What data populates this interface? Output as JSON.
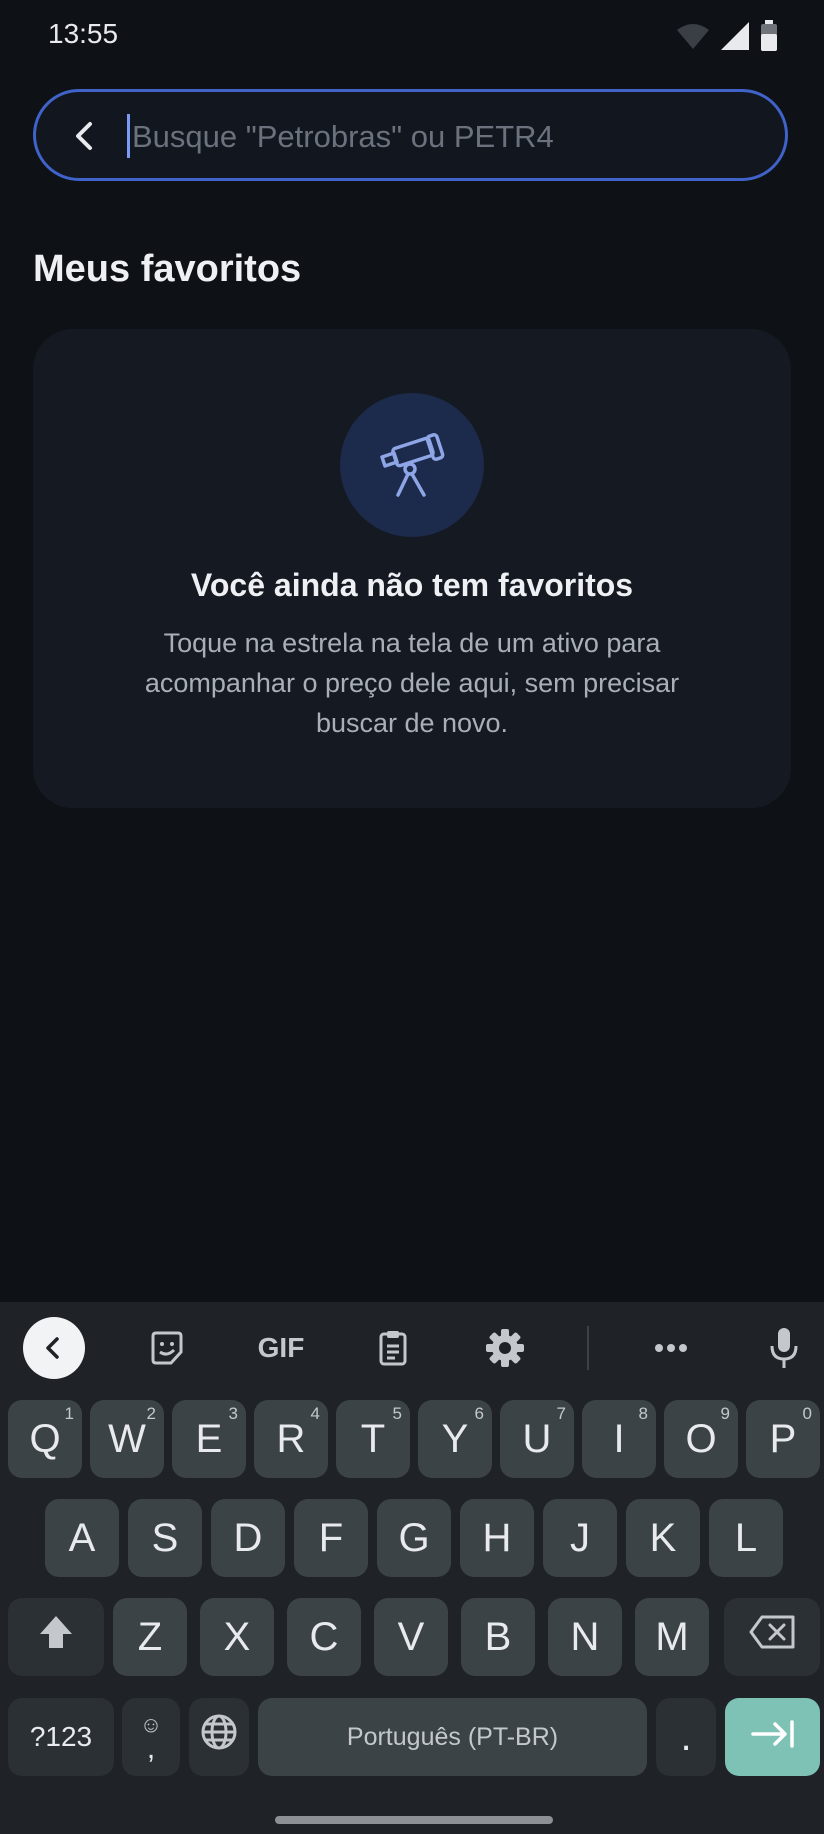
{
  "status_bar": {
    "time": "13:55",
    "icons": [
      "wifi-icon",
      "signal-icon",
      "battery-icon"
    ]
  },
  "search": {
    "placeholder": "Busque \"Petrobras\" ou PETR4",
    "value": ""
  },
  "favorites": {
    "section_title": "Meus favoritos",
    "empty_title": "Você ainda não tem favoritos",
    "empty_description": "Toque na estrela na tela de um ativo para acompanhar o preço dele aqui, sem precisar buscar de novo.",
    "icon": "telescope-icon"
  },
  "keyboard": {
    "toolbar": {
      "gif_label": "GIF",
      "icons": [
        "chevron-left-icon",
        "sticker-icon",
        "gif-icon",
        "clipboard-icon",
        "gear-icon",
        "more-icon",
        "mic-icon"
      ]
    },
    "row1": [
      {
        "key": "Q",
        "hint": "1"
      },
      {
        "key": "W",
        "hint": "2"
      },
      {
        "key": "E",
        "hint": "3"
      },
      {
        "key": "R",
        "hint": "4"
      },
      {
        "key": "T",
        "hint": "5"
      },
      {
        "key": "Y",
        "hint": "6"
      },
      {
        "key": "U",
        "hint": "7"
      },
      {
        "key": "I",
        "hint": "8"
      },
      {
        "key": "O",
        "hint": "9"
      },
      {
        "key": "P",
        "hint": "0"
      }
    ],
    "row2": [
      "A",
      "S",
      "D",
      "F",
      "G",
      "H",
      "J",
      "K",
      "L"
    ],
    "row3": [
      "Z",
      "X",
      "C",
      "V",
      "B",
      "N",
      "M"
    ],
    "symbols_label": "?123",
    "emoji_comma_label": ",",
    "space_label": "Português (PT-BR)",
    "period_label": ".",
    "colors": {
      "accent": "#3f63c9",
      "enter": "#7ec2b5"
    }
  }
}
